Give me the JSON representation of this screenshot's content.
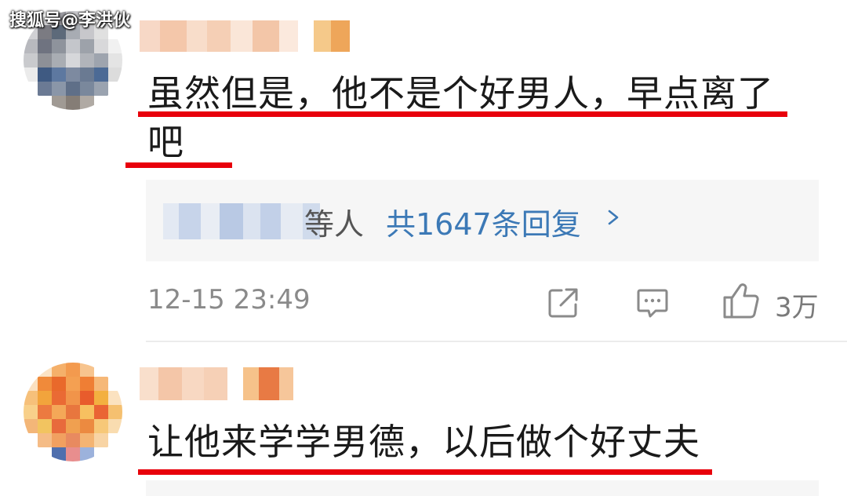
{
  "watermark": "搜狐号@李洪伙",
  "comments": [
    {
      "body_line1": "虽然但是，他不是个好男人，早点离了",
      "body_line2": "吧",
      "reply_suffix": "等人",
      "reply_count": "共1647条回复",
      "timestamp": "12-15 23:49",
      "like_count": "3万"
    },
    {
      "body_line1": "让他来学学男德，以后做个好丈夫"
    }
  ],
  "colors": {
    "underline": "#e8000b",
    "link": "#3c79b6",
    "muted": "#8a8a8a"
  },
  "icons": [
    "share-icon",
    "comment-icon",
    "like-icon",
    "chevron-right-icon"
  ]
}
